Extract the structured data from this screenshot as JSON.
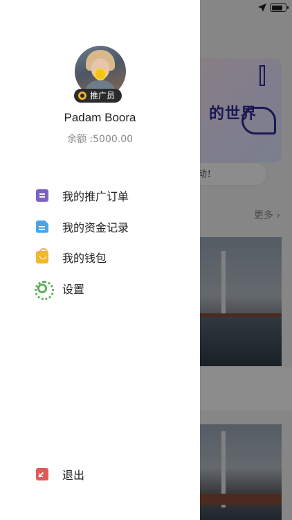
{
  "background": {
    "banner_headline": "的世界",
    "pill_text": "动！",
    "more_label": "更多"
  },
  "drawer": {
    "badge_label": "推广员",
    "username": "Padam Boora",
    "balance_text": "余额 :5000.00",
    "menu": [
      {
        "label": "我的推广订单",
        "icon": "order-icon",
        "color": "#7b62c4"
      },
      {
        "label": "我的资金记录",
        "icon": "document-icon",
        "color": "#4aa5e8"
      },
      {
        "label": "我的钱包",
        "icon": "wallet-bag-icon",
        "color": "#f0b82e"
      },
      {
        "label": "设置",
        "icon": "gear-icon",
        "color": "#5fae5b"
      }
    ],
    "logout_label": "退出",
    "logout_icon": "logout-icon"
  },
  "status_bar": {
    "icons": [
      "location-arrow-icon",
      "battery-icon"
    ],
    "battery_level": 0.85
  }
}
